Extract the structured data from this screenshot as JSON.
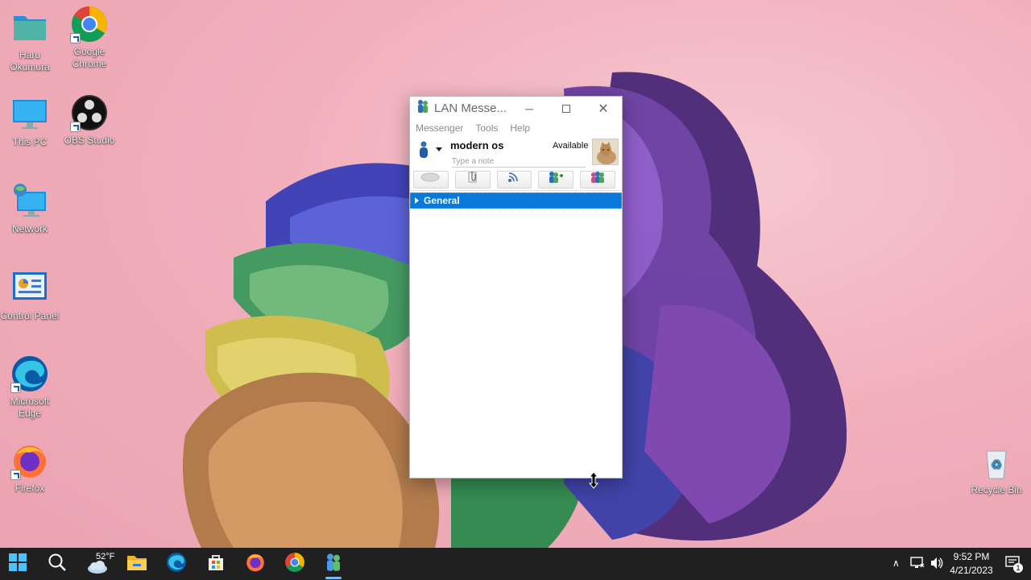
{
  "desktop": {
    "icons": [
      {
        "id": "haru",
        "label": "Haru Okumura"
      },
      {
        "id": "chrome",
        "label": "Google Chrome"
      },
      {
        "id": "thispc",
        "label": "This PC"
      },
      {
        "id": "obs",
        "label": "OBS Studio"
      },
      {
        "id": "network",
        "label": "Network"
      },
      {
        "id": "control",
        "label": "Control Panel"
      },
      {
        "id": "edge",
        "label": "Microsoft Edge"
      },
      {
        "id": "firefox",
        "label": "Firefox"
      },
      {
        "id": "recycle",
        "label": "Recycle Bin"
      }
    ]
  },
  "window": {
    "title": "LAN Messe...",
    "menu": [
      "Messenger",
      "Tools",
      "Help"
    ],
    "profile": {
      "name": "modern os",
      "status": "Available",
      "note_placeholder": "Type a note"
    },
    "groups": [
      {
        "label": "General"
      }
    ]
  },
  "taskbar": {
    "weather": "52°F",
    "time": "9:52 PM",
    "date": "4/21/2023",
    "notification_count": "1"
  },
  "icons": {
    "window_app": "lan-messenger-icon",
    "minimize": "minimize-icon",
    "maximize": "maximize-icon",
    "close": "close-icon"
  },
  "colors": {
    "accent": "#0a78d7",
    "taskbar": "#202020"
  }
}
